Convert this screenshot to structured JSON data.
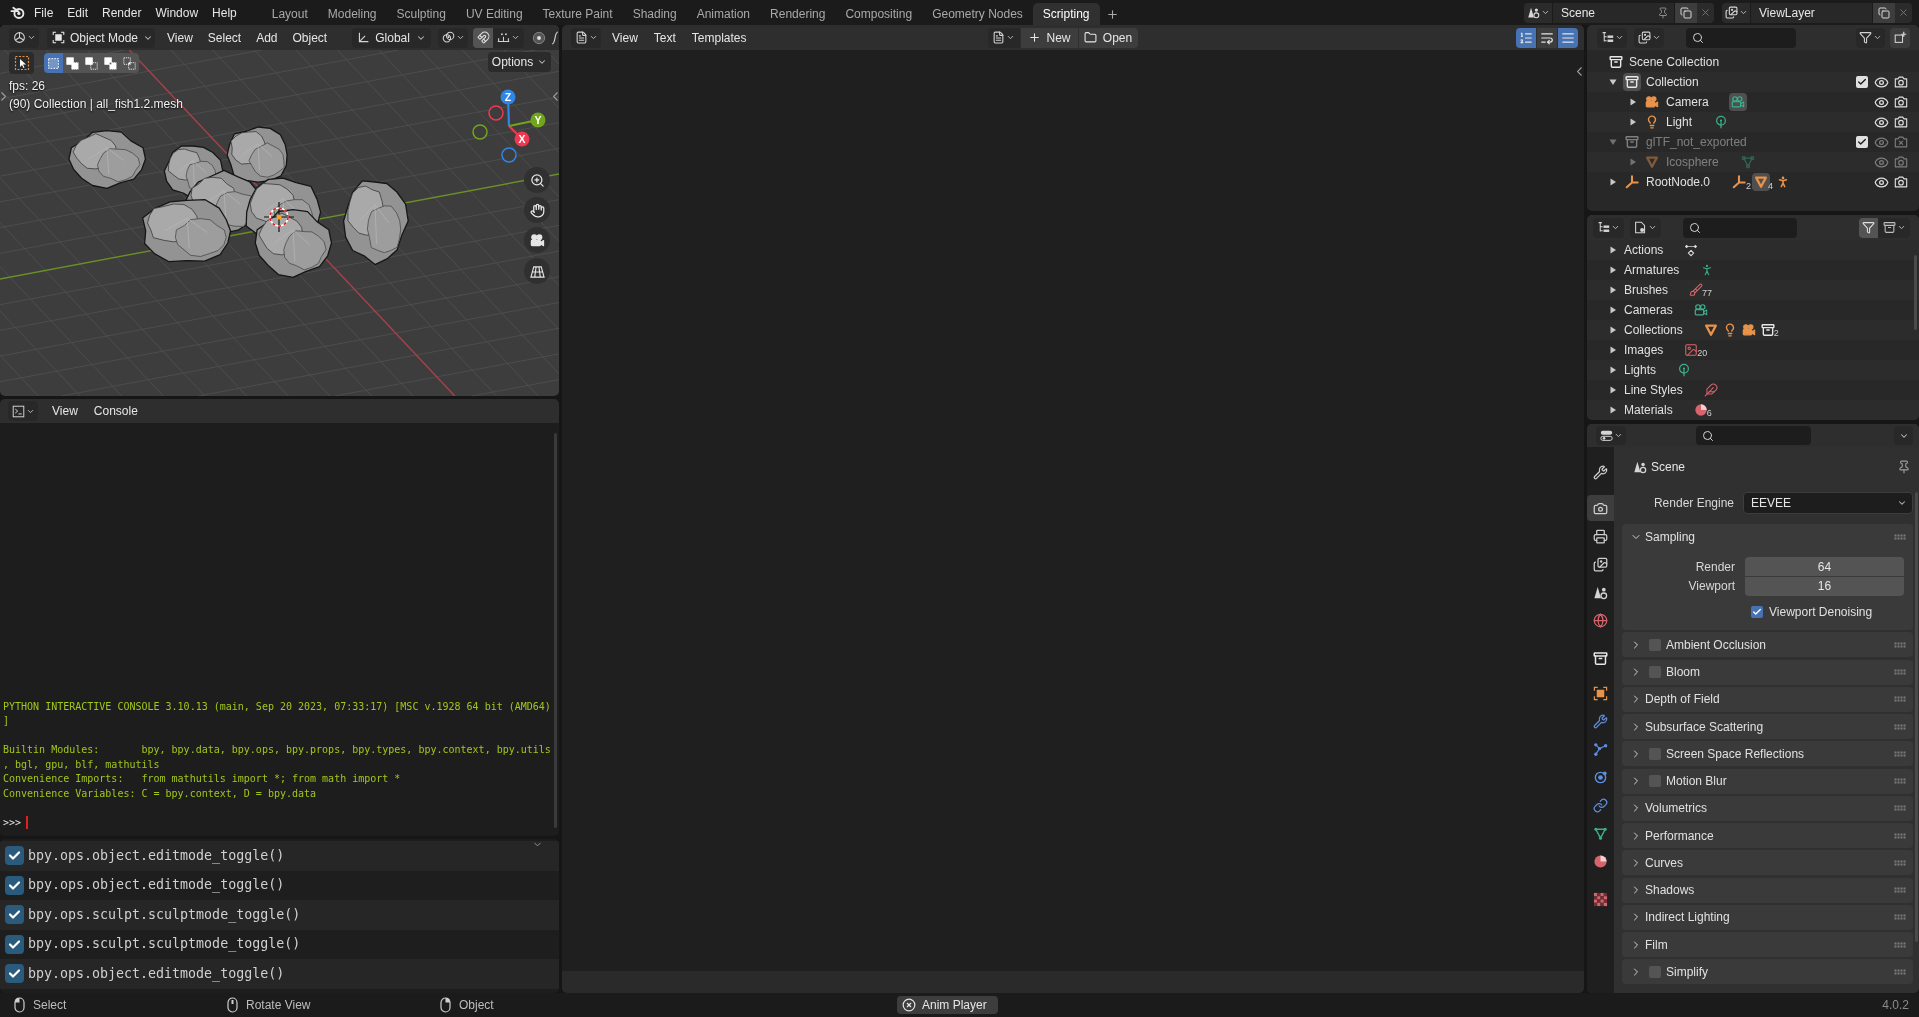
{
  "top_bar": {
    "menus": [
      "File",
      "Edit",
      "Render",
      "Window",
      "Help"
    ],
    "workspaces": [
      {
        "label": "Layout",
        "selected": false
      },
      {
        "label": "Modeling",
        "selected": false
      },
      {
        "label": "Sculpting",
        "selected": false
      },
      {
        "label": "UV Editing",
        "selected": false
      },
      {
        "label": "Texture Paint",
        "selected": false
      },
      {
        "label": "Shading",
        "selected": false
      },
      {
        "label": "Animation",
        "selected": false
      },
      {
        "label": "Rendering",
        "selected": false
      },
      {
        "label": "Compositing",
        "selected": false
      },
      {
        "label": "Geometry Nodes",
        "selected": false
      },
      {
        "label": "Scripting",
        "selected": true
      }
    ],
    "scene": "Scene",
    "view_layer": "ViewLayer"
  },
  "viewport": {
    "mode": "Object Mode",
    "menus": [
      "View",
      "Select",
      "Add",
      "Object"
    ],
    "orientation": "Global",
    "snapping": false,
    "proportional_editing": false,
    "select_modes": [
      {
        "kind": "new",
        "selected": true
      },
      {
        "kind": "extend",
        "selected": false
      },
      {
        "kind": "subtract",
        "selected": false
      },
      {
        "kind": "invert",
        "selected": false
      },
      {
        "kind": "intersect",
        "selected": false
      }
    ],
    "options": "Options",
    "fps": "fps: 26",
    "object_info": "(90) Collection | all_fish1.2.mesh",
    "gizmo_axes": [
      {
        "label": "X",
        "color": "#f0384f"
      },
      {
        "label": "Y",
        "color": "#72a51c"
      },
      {
        "label": "Z",
        "color": "#2f86e8"
      }
    ]
  },
  "console": {
    "menus": [
      "View",
      "Console"
    ],
    "blocks": [
      [
        "PYTHON INTERACTIVE CONSOLE 3.10.13 (main, Sep 20 2023, 07:33:17) [MSC v.1928 64 bit (AMD64)",
        "]"
      ],
      [
        "Builtin Modules:       bpy, bpy.data, bpy.ops, bpy.props, bpy.types, bpy.context, bpy.utils",
        ", bgl, gpu, blf, mathutils",
        "Convenience Imports:   from mathutils import *; from math import *",
        "Convenience Variables: C = bpy.context, D = bpy.data"
      ]
    ],
    "prompt": ">>>"
  },
  "info": {
    "reports": [
      "bpy.ops.object.editmode_toggle()",
      "bpy.ops.object.editmode_toggle()",
      "bpy.ops.sculpt.sculptmode_toggle()",
      "bpy.ops.sculpt.sculptmode_toggle()",
      "bpy.ops.object.editmode_toggle()"
    ]
  },
  "text_editor": {
    "menus": [
      "View",
      "Text",
      "Templates"
    ],
    "new": "New",
    "open": "Open",
    "toggles": [
      {
        "kind": "line_numbers",
        "selected": true
      },
      {
        "kind": "word_wrap",
        "selected": false
      },
      {
        "kind": "syntax_highlight",
        "selected": true
      }
    ]
  },
  "outliner": {
    "root": "Scene Collection",
    "tree": [
      {
        "label": "Collection",
        "kind": "collection",
        "expanded": true,
        "active": true,
        "checked": true,
        "dimmed": false,
        "renderable": true,
        "children": [
          {
            "label": "Camera",
            "kind": "camera",
            "expanded": false,
            "active": false,
            "dimmed": false,
            "renderable": true,
            "data": [
              {
                "kind": "camera_data",
                "active": true
              }
            ]
          },
          {
            "label": "Light",
            "kind": "light",
            "expanded": false,
            "active": false,
            "dimmed": false,
            "renderable": true,
            "data": [
              {
                "kind": "light_data",
                "active": false
              }
            ]
          }
        ]
      },
      {
        "label": "glTF_not_exported",
        "kind": "collection",
        "expanded": true,
        "active": false,
        "checked": true,
        "dimmed": true,
        "renderable": false,
        "children": [
          {
            "label": "Icosphere",
            "kind": "mesh",
            "expanded": false,
            "active": false,
            "dimmed": true,
            "renderable": true,
            "data": [
              {
                "kind": "mesh_data",
                "active": false
              }
            ]
          }
        ]
      },
      {
        "label": "RootNode.0",
        "kind": "empty",
        "expanded": false,
        "active": false,
        "dimmed": false,
        "renderable": true,
        "data": [
          {
            "kind": "empty",
            "count": "2",
            "active": false
          },
          {
            "kind": "mesh_object",
            "count": "4",
            "active": true
          },
          {
            "kind": "armature_object",
            "active": false
          }
        ]
      }
    ]
  },
  "blend_file": {
    "filter_active": true,
    "categories": [
      {
        "label": "Actions",
        "expanded": false,
        "icons": [
          {
            "kind": "action"
          }
        ]
      },
      {
        "label": "Armatures",
        "expanded": false,
        "icons": [
          {
            "kind": "armature"
          }
        ]
      },
      {
        "label": "Brushes",
        "expanded": false,
        "icons": [
          {
            "kind": "brush",
            "count": "77"
          }
        ]
      },
      {
        "label": "Cameras",
        "expanded": false,
        "icons": [
          {
            "kind": "camera_data"
          }
        ]
      },
      {
        "label": "Collections",
        "expanded": false,
        "icons": [
          {
            "kind": "mesh_object"
          },
          {
            "kind": "light_object"
          },
          {
            "kind": "camera_object"
          },
          {
            "kind": "collection",
            "count": "2"
          }
        ]
      },
      {
        "label": "Images",
        "expanded": false,
        "icons": [
          {
            "kind": "image",
            "count": "20"
          }
        ]
      },
      {
        "label": "Lights",
        "expanded": false,
        "icons": [
          {
            "kind": "light_data"
          }
        ]
      },
      {
        "label": "Line Styles",
        "expanded": false,
        "icons": [
          {
            "kind": "linestyle"
          }
        ]
      },
      {
        "label": "Materials",
        "expanded": false,
        "icons": [
          {
            "kind": "material",
            "count": "6"
          }
        ]
      }
    ]
  },
  "properties": {
    "tabs": [
      {
        "kind": "tool",
        "selected": false
      },
      {
        "kind": "render",
        "selected": true
      },
      {
        "kind": "output",
        "selected": false
      },
      {
        "kind": "view_layer",
        "selected": false
      },
      {
        "kind": "scene",
        "selected": false
      },
      {
        "kind": "world",
        "selected": false
      },
      {
        "kind": "collection",
        "selected": false
      },
      {
        "kind": "object",
        "selected": false
      },
      {
        "kind": "modifiers",
        "selected": false
      },
      {
        "kind": "particles",
        "selected": false
      },
      {
        "kind": "physics",
        "selected": false
      },
      {
        "kind": "constraints",
        "selected": false
      },
      {
        "kind": "data",
        "selected": false
      },
      {
        "kind": "material",
        "selected": false
      },
      {
        "kind": "texture",
        "selected": false
      }
    ],
    "context": "Scene",
    "engine_label": "Render Engine",
    "engine": "EEVEE",
    "panels": [
      {
        "label": "Sampling",
        "expanded": true,
        "fields": [
          {
            "label": "Render",
            "value": "64"
          },
          {
            "label": "Viewport",
            "value": "16"
          }
        ],
        "toggle": {
          "label": "Viewport Denoising",
          "checked": true
        }
      },
      {
        "label": "Ambient Occlusion",
        "expanded": false,
        "checked": false
      },
      {
        "label": "Bloom",
        "expanded": false,
        "checked": false
      },
      {
        "label": "Depth of Field",
        "expanded": false
      },
      {
        "label": "Subsurface Scattering",
        "expanded": false
      },
      {
        "label": "Screen Space Reflections",
        "expanded": false,
        "checked": false
      },
      {
        "label": "Motion Blur",
        "expanded": false,
        "checked": false
      },
      {
        "label": "Volumetrics",
        "expanded": false
      },
      {
        "label": "Performance",
        "expanded": false
      },
      {
        "label": "Curves",
        "expanded": false
      },
      {
        "label": "Shadows",
        "expanded": false
      },
      {
        "label": "Indirect Lighting",
        "expanded": false
      },
      {
        "label": "Film",
        "expanded": false
      },
      {
        "label": "Simplify",
        "expanded": false,
        "checked": false
      }
    ]
  },
  "status_bar": {
    "hints": [
      {
        "kind": "left_mouse",
        "label": "Select"
      },
      {
        "kind": "middle_mouse",
        "label": "Rotate View"
      },
      {
        "kind": "right_mouse",
        "label": "Object"
      }
    ],
    "job": "Anim Player",
    "version": "4.0.2"
  }
}
